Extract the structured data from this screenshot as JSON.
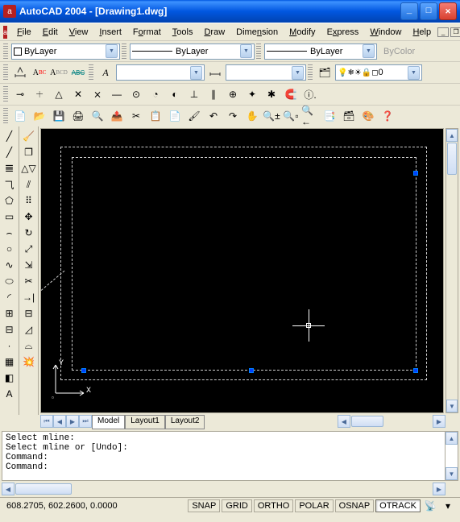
{
  "titlebar": {
    "app": "AutoCAD 2004",
    "doc": "[Drawing1.dwg]"
  },
  "menu": [
    "File",
    "Edit",
    "View",
    "Insert",
    "Format",
    "Tools",
    "Draw",
    "Dimension",
    "Modify",
    "Express",
    "Window",
    "Help"
  ],
  "layer_combo": {
    "label": "ByLayer",
    "lt_label": "ByLayer",
    "lw_label": "ByLayer",
    "bycolor": "ByColor"
  },
  "layer_state": "0",
  "tabs": {
    "model": "Model",
    "l1": "Layout1",
    "l2": "Layout2"
  },
  "cmd": {
    "l1": "Select mline:",
    "l2": "Select mline or [Undo]:",
    "l3": "Command:",
    "l4": "Command:"
  },
  "status": {
    "coords": "608.2705, 602.2600, 0.0000",
    "snap": "SNAP",
    "grid": "GRID",
    "ortho": "ORTHO",
    "polar": "POLAR",
    "osnap": "OSNAP",
    "otrack": "OTRACK"
  },
  "ucs": {
    "x": "X",
    "y": "Y"
  }
}
